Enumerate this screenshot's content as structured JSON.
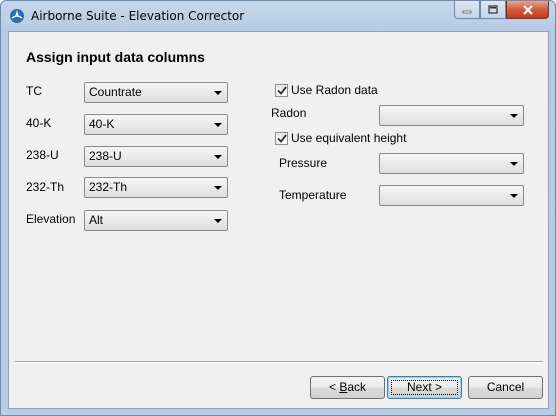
{
  "window": {
    "title": "Airborne Suite - Elevation Corrector",
    "icon": "airborne-suite-app-icon"
  },
  "titlebar_buttons": [
    "minimize-icon",
    "maximize-icon",
    "close-icon"
  ],
  "heading": "Assign input data columns",
  "left_fields": [
    {
      "label": "TC",
      "value": "Countrate"
    },
    {
      "label": "40-K",
      "value": "40-K"
    },
    {
      "label": "238-U",
      "value": "238-U"
    },
    {
      "label": "232-Th",
      "value": "232-Th"
    },
    {
      "label": "Elevation",
      "value": "Alt"
    }
  ],
  "radon": {
    "checkbox_label": "Use Radon data",
    "checked": true,
    "field_label": "Radon",
    "value": ""
  },
  "equivalent_height": {
    "checkbox_label": "Use equivalent height",
    "checked": true,
    "pressure_label": "Pressure",
    "pressure_value": "",
    "temperature_label": "Temperature",
    "temperature_value": ""
  },
  "buttons": {
    "back_prefix": "< ",
    "back_mnemonic": "B",
    "back_rest": "ack",
    "next": "Next >",
    "cancel": "Cancel"
  }
}
